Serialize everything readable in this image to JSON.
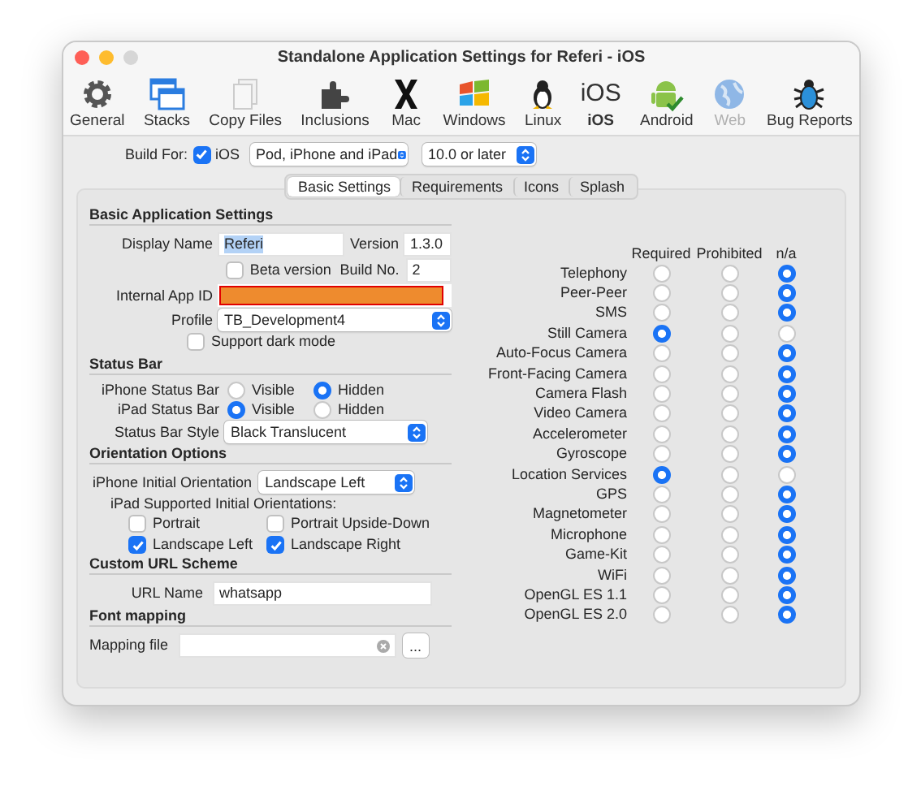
{
  "window": {
    "title": "Standalone Application Settings for Referi - iOS"
  },
  "toolbar": [
    {
      "label": "General",
      "selected": false,
      "disabled": false
    },
    {
      "label": "Stacks",
      "selected": false,
      "disabled": false
    },
    {
      "label": "Copy Files",
      "selected": false,
      "disabled": false
    },
    {
      "label": "Inclusions",
      "selected": false,
      "disabled": false
    },
    {
      "label": "Mac",
      "selected": false,
      "disabled": false
    },
    {
      "label": "Windows",
      "selected": false,
      "disabled": false
    },
    {
      "label": "Linux",
      "selected": false,
      "disabled": false
    },
    {
      "label": "iOS",
      "selected": true,
      "disabled": false,
      "glyph": "iOS"
    },
    {
      "label": "Android",
      "selected": false,
      "disabled": false
    },
    {
      "label": "Web",
      "selected": false,
      "disabled": true
    },
    {
      "label": "Bug Reports",
      "selected": false,
      "disabled": false
    }
  ],
  "build_for": {
    "label": "Build For:",
    "checkbox": {
      "label": "iOS",
      "checked": true
    },
    "devices": "Pod, iPhone and iPad",
    "version": "10.0 or later"
  },
  "tabs": [
    {
      "label": "Basic Settings",
      "selected": true
    },
    {
      "label": "Requirements",
      "selected": false
    },
    {
      "label": "Icons",
      "selected": false
    },
    {
      "label": "Splash",
      "selected": false
    }
  ],
  "basic": {
    "heading": "Basic Application Settings",
    "display_name_label": "Display Name",
    "display_name": "Referi",
    "version_label": "Version",
    "version": "1.3.0",
    "beta": {
      "label": "Beta version",
      "checked": false
    },
    "build_label": "Build No.",
    "build": "2",
    "app_id_label": "Internal App ID",
    "profile_label": "Profile",
    "profile": "TB_Development4",
    "dark_mode": {
      "label": "Support dark mode",
      "checked": false
    }
  },
  "status_bar": {
    "heading": "Status Bar",
    "rows": [
      {
        "label": "iPhone Status Bar",
        "options": [
          {
            "label": "Visible",
            "selected": false
          },
          {
            "label": "Hidden",
            "selected": true
          }
        ]
      },
      {
        "label": "iPad Status Bar",
        "options": [
          {
            "label": "Visible",
            "selected": true
          },
          {
            "label": "Hidden",
            "selected": false
          }
        ]
      }
    ],
    "style_label": "Status Bar Style",
    "style": "Black Translucent"
  },
  "orientation": {
    "heading": "Orientation Options",
    "iphone_label": "iPhone Initial Orientation",
    "iphone": "Landscape Left",
    "ipad_label": "iPad Supported Initial Orientations:",
    "ipad": [
      {
        "label": "Portrait",
        "checked": false
      },
      {
        "label": "Portrait Upside-Down",
        "checked": false
      },
      {
        "label": "Landscape Left",
        "checked": true
      },
      {
        "label": "Landscape Right",
        "checked": true
      }
    ]
  },
  "url_scheme": {
    "heading": "Custom URL Scheme",
    "label": "URL Name",
    "value": "whatsapp"
  },
  "font_mapping": {
    "heading": "Font mapping",
    "label": "Mapping file",
    "browse": "..."
  },
  "requirements": {
    "columns": [
      "Required",
      "Prohibited",
      "n/a"
    ],
    "rows": [
      {
        "label": "Telephony",
        "options": [
          {
            "selected": false
          },
          {
            "selected": false
          },
          {
            "selected": true
          }
        ]
      },
      {
        "label": "Peer-Peer",
        "options": [
          {
            "selected": false
          },
          {
            "selected": false
          },
          {
            "selected": true
          }
        ]
      },
      {
        "label": "SMS",
        "options": [
          {
            "selected": false
          },
          {
            "selected": false
          },
          {
            "selected": true
          }
        ]
      },
      {
        "label": "Still Camera",
        "options": [
          {
            "selected": true
          },
          {
            "selected": false
          },
          {
            "selected": false
          }
        ]
      },
      {
        "label": "Auto-Focus Camera",
        "options": [
          {
            "selected": false
          },
          {
            "selected": false
          },
          {
            "selected": true
          }
        ]
      },
      {
        "label": "Front-Facing Camera",
        "options": [
          {
            "selected": false
          },
          {
            "selected": false
          },
          {
            "selected": true
          }
        ]
      },
      {
        "label": "Camera Flash",
        "options": [
          {
            "selected": false
          },
          {
            "selected": false
          },
          {
            "selected": true
          }
        ]
      },
      {
        "label": "Video Camera",
        "options": [
          {
            "selected": false
          },
          {
            "selected": false
          },
          {
            "selected": true
          }
        ]
      },
      {
        "label": "Accelerometer",
        "options": [
          {
            "selected": false
          },
          {
            "selected": false
          },
          {
            "selected": true
          }
        ]
      },
      {
        "label": "Gyroscope",
        "options": [
          {
            "selected": false
          },
          {
            "selected": false
          },
          {
            "selected": true
          }
        ]
      },
      {
        "label": "Location Services",
        "options": [
          {
            "selected": true
          },
          {
            "selected": false
          },
          {
            "selected": false
          }
        ]
      },
      {
        "label": "GPS",
        "options": [
          {
            "selected": false
          },
          {
            "selected": false
          },
          {
            "selected": true
          }
        ]
      },
      {
        "label": "Magnetometer",
        "options": [
          {
            "selected": false
          },
          {
            "selected": false
          },
          {
            "selected": true
          }
        ]
      },
      {
        "label": "Microphone",
        "options": [
          {
            "selected": false
          },
          {
            "selected": false
          },
          {
            "selected": true
          }
        ]
      },
      {
        "label": "Game-Kit",
        "options": [
          {
            "selected": false
          },
          {
            "selected": false
          },
          {
            "selected": true
          }
        ]
      },
      {
        "label": "WiFi",
        "options": [
          {
            "selected": false
          },
          {
            "selected": false
          },
          {
            "selected": true
          }
        ]
      },
      {
        "label": "OpenGL ES 1.1",
        "options": [
          {
            "selected": false
          },
          {
            "selected": false
          },
          {
            "selected": true
          }
        ]
      },
      {
        "label": "OpenGL ES 2.0",
        "options": [
          {
            "selected": false
          },
          {
            "selected": false
          },
          {
            "selected": true
          }
        ]
      }
    ]
  }
}
